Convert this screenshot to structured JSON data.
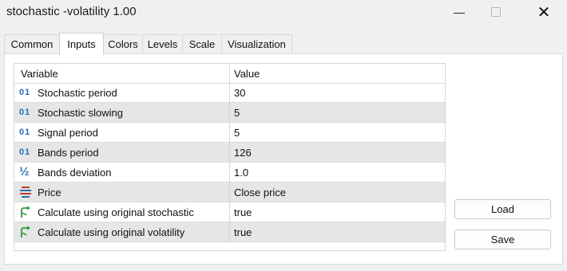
{
  "window": {
    "title": "stochastic -volatility 1.00",
    "minimize": "—",
    "close": "✕"
  },
  "tabs": [
    {
      "label": "Common"
    },
    {
      "label": "Inputs"
    },
    {
      "label": "Colors"
    },
    {
      "label": "Levels"
    },
    {
      "label": "Scale"
    },
    {
      "label": "Visualization"
    }
  ],
  "active_tab": "Inputs",
  "grid": {
    "headers": {
      "variable": "Variable",
      "value": "Value"
    },
    "rows": [
      {
        "icon": "integer-icon",
        "variable": "Stochastic period",
        "value": "30"
      },
      {
        "icon": "integer-icon",
        "variable": "Stochastic slowing",
        "value": "5"
      },
      {
        "icon": "integer-icon",
        "variable": "Signal period",
        "value": "5"
      },
      {
        "icon": "integer-icon",
        "variable": "Bands period",
        "value": "126"
      },
      {
        "icon": "fraction-icon",
        "variable": "Bands deviation",
        "value": "1.0"
      },
      {
        "icon": "enum-icon",
        "variable": "Price",
        "value": "Close price"
      },
      {
        "icon": "boolean-icon",
        "variable": "Calculate using original stochastic",
        "value": "true"
      },
      {
        "icon": "boolean-icon",
        "variable": "Calculate using original volatility",
        "value": "true"
      }
    ]
  },
  "buttons": {
    "load": "Load",
    "save": "Save"
  },
  "icon_labels": {
    "integer": "01",
    "fraction": "½"
  },
  "colors": {
    "integer_icon": "#2a6fb0",
    "boolean_icon": "#2e9a3c",
    "enum_icon": "#c0392b",
    "alt_row": "#e6e6e6"
  }
}
